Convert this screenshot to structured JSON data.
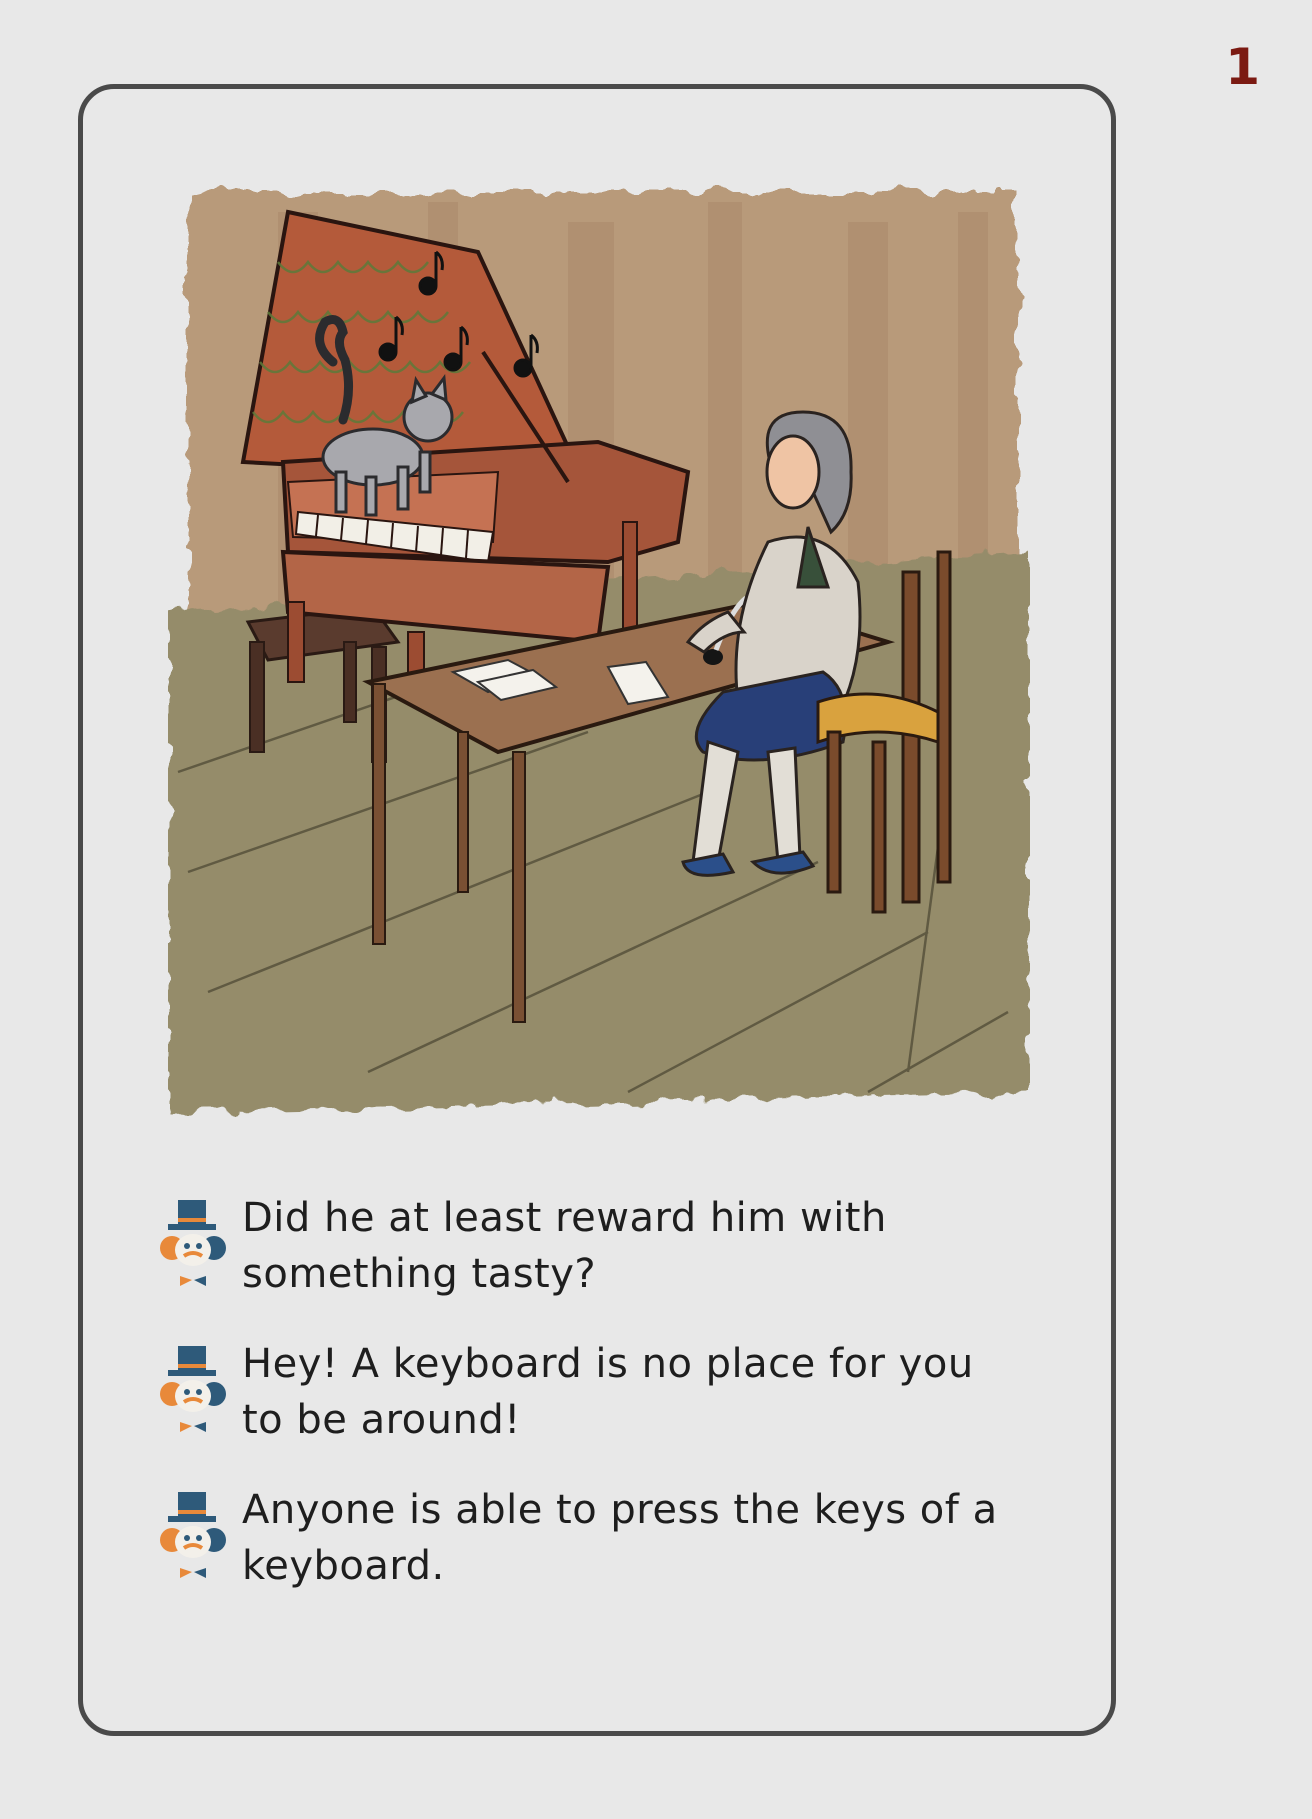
{
  "page": {
    "number": "1",
    "number_color": "#7b1a12"
  },
  "illustration": {
    "description_icon": "harpsichord-cat-composer-illustration"
  },
  "options": [
    {
      "text": "Did he at least reward him with something tasty?",
      "icon": "top-hat-character-icon"
    },
    {
      "text": "Hey! A keyboard is no place for you to be around!",
      "icon": "top-hat-character-icon"
    },
    {
      "text": "Anyone is able to press the keys of a keyboard.",
      "icon": "top-hat-character-icon"
    }
  ],
  "colors": {
    "frame": "#4a4a4a",
    "background": "#e8e8e8",
    "hat": "#2e5a7a",
    "accent_orange": "#e8893a"
  }
}
